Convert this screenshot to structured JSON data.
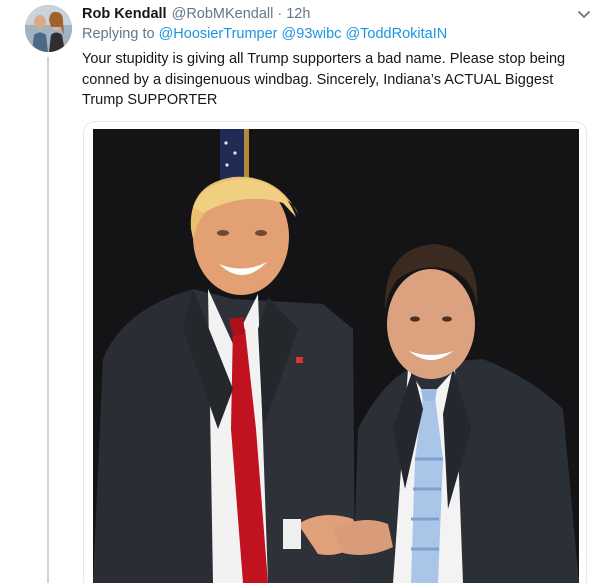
{
  "tweet": {
    "author": {
      "name": "Rob Kendall",
      "handle": "@RobMKendall",
      "time": "12h"
    },
    "reply_prefix": "Replying to",
    "reply_mentions": [
      "@HoosierTrumper",
      "@93wibc",
      "@ToddRokitaIN"
    ],
    "text": "Your stupidity is giving all Trump supporters a bad name. Please stop being conned by a disingenuous windbag. Sincerely, Indiana’s ACTUAL Biggest Trump SUPPORTER",
    "separator": "·"
  },
  "icons": {
    "more": "chevron-down-icon"
  },
  "colors": {
    "link": "#1b95e0",
    "secondary_text": "#657786",
    "thread_line": "#ccd6dd"
  }
}
